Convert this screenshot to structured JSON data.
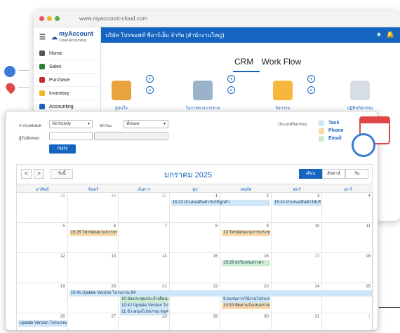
{
  "browser": {
    "url": "www.myaccount-cloud.com",
    "dots": [
      "#e85454",
      "#f0b429",
      "#4caf50"
    ]
  },
  "app": {
    "logo": "myAccount",
    "logo_sub": "Cloud Accounting",
    "company": "บริษัท โปรซอฟท์ ซีอาร์เอ็ม จำกัด (สำนักงานใหญ่)",
    "sidebar": [
      {
        "label": "Home",
        "color": "#555"
      },
      {
        "label": "Sales",
        "color": "#2e7d32"
      },
      {
        "label": "Purchase",
        "color": "#c62828"
      },
      {
        "label": "Inventory",
        "color": "#f0b429"
      },
      {
        "label": "Accounting",
        "color": "#1565c0"
      }
    ],
    "tabs": [
      "CRM",
      "Work Flow"
    ],
    "modules": [
      {
        "label": "ผู้สนใจ",
        "color": "#e8a33d"
      },
      {
        "label": "โอกาสทางการขาย",
        "color": "#9ab3c9"
      },
      {
        "label": "กิจกรรม",
        "color": "#f6b73c"
      },
      {
        "label": "ปฏิทินกิจกรรม",
        "color": "#d6dde5"
      }
    ]
  },
  "filter": {
    "type_label": "การแสดงผล",
    "type_value": "All Activity",
    "status_label": "สถานะ",
    "status_value": "ทั้งหมด",
    "owner_label": "ผู้รับผิดชอบ",
    "apply": "Apply",
    "legend_title": "ประเภทกิจกรรม",
    "legend": [
      {
        "label": "Task",
        "color": "#cfe6f7"
      },
      {
        "label": "Phone",
        "color": "#f9d9a8"
      },
      {
        "label": "Email",
        "color": "#cdebd0"
      }
    ]
  },
  "calendar": {
    "prev": "<",
    "next": ">",
    "today": "วันนี้",
    "month": "มกราคม 2025",
    "views": [
      "เดือน",
      "สัปดาห์",
      "วัน"
    ],
    "days": [
      "อาทิตย์",
      "จันทร์",
      "อังคาร",
      "พุธ",
      "พฤหัส",
      "ศุกร์",
      "เสาร์"
    ],
    "weeks": [
      [
        "29",
        "30",
        "31",
        "1",
        "2",
        "3",
        "4"
      ],
      [
        "5",
        "6",
        "7",
        "8",
        "9",
        "10",
        "11"
      ],
      [
        "12",
        "13",
        "14",
        "15",
        "16",
        "17",
        "18"
      ],
      [
        "19",
        "20",
        "21",
        "22",
        "23",
        "24",
        "25"
      ],
      [
        "26",
        "27",
        "28",
        "29",
        "30",
        "31",
        "1"
      ]
    ],
    "events": [
      {
        "text": "15:23 นำเสนอสินค้ากับให้ลูกค้า",
        "week": 0,
        "day": 3,
        "span": 2,
        "slot": 0,
        "color": "#cfe6f7"
      },
      {
        "text": "15:24 นำเสนอสินค้าให้บริ",
        "week": 0,
        "day": 5,
        "span": 1,
        "slot": 0,
        "color": "#cfe6f7"
      },
      {
        "text": "15:25 โทรนัดหมายการประ",
        "week": 1,
        "day": 1,
        "span": 1,
        "slot": 0,
        "color": "#f9d9a8"
      },
      {
        "text": "13 โทรนัดหมายการประชุม",
        "week": 1,
        "day": 4,
        "span": 1,
        "slot": 0,
        "color": "#f9d9a8"
      },
      {
        "text": "15:28 ส่งใบเสนอราคา",
        "week": 2,
        "day": 4,
        "span": 1,
        "slot": 0,
        "color": "#cdebd0"
      },
      {
        "text": "10:41 Update Version โปรแกรม 84",
        "week": 3,
        "day": 1,
        "span": 6,
        "slot": 0,
        "color": "#cfe6f7"
      },
      {
        "text": "10 นัดประชุมประจำเดือนก",
        "week": 3,
        "day": 2,
        "span": 1,
        "slot": 1,
        "color": "#cdebd0"
      },
      {
        "text": "10:42 Update Version โป",
        "week": 3,
        "day": 2,
        "span": 1,
        "slot": 2,
        "color": "#cfe6f7"
      },
      {
        "text": "11 นำเสนอโปรแกรม myA",
        "week": 3,
        "day": 2,
        "span": 1,
        "slot": 3,
        "color": "#cfe6f7"
      },
      {
        "text": "9 อบรมการใช้งานโปรแกรม",
        "week": 3,
        "day": 4,
        "span": 1,
        "slot": 1,
        "color": "#cfe6f7"
      },
      {
        "text": "10:53 ติดตามใบเสนอราค",
        "week": 3,
        "day": 4,
        "span": 1,
        "slot": 2,
        "color": "#f9d9a8"
      },
      {
        "text": "Update Version โปรแกรม 84",
        "week": 4,
        "day": 0,
        "span": 1,
        "slot": 0,
        "color": "#cfe6f7"
      }
    ]
  }
}
